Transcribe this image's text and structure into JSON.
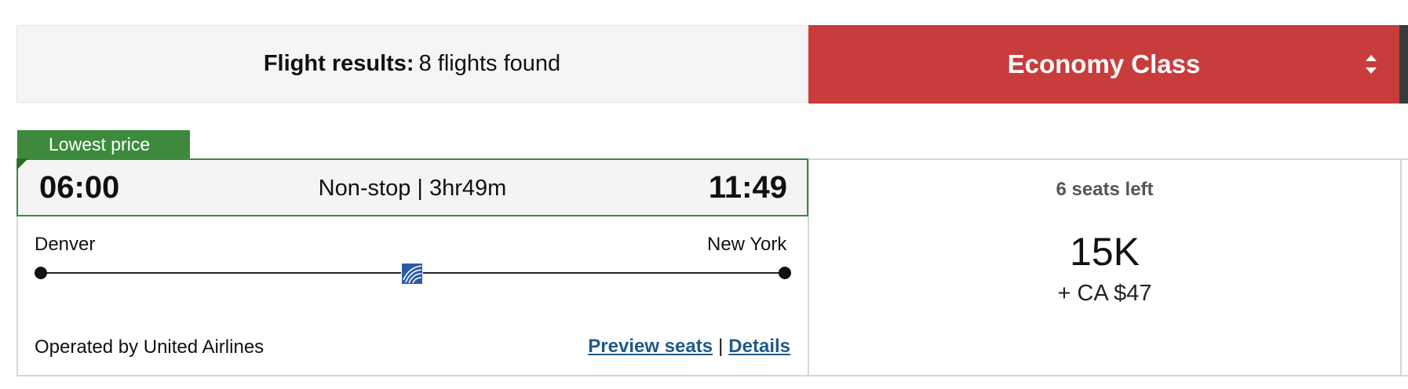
{
  "header": {
    "results_label": "Flight results:",
    "results_count": "8 flights found",
    "cabin_class": "Economy Class"
  },
  "flight": {
    "badge": "Lowest price",
    "departure_time": "06:00",
    "duration": "Non-stop | 3hr49m",
    "arrival_time": "11:49",
    "origin_city": "Denver",
    "destination_city": "New York",
    "operator": "Operated by United Airlines",
    "preview_seats_label": "Preview seats",
    "separator": "|",
    "details_label": "Details",
    "airline_logo_icon": "united-airlines-globe-icon"
  },
  "fare": {
    "seats_left": "6 seats left",
    "miles": "15K",
    "taxes": "+ CA $47"
  },
  "colors": {
    "cabin_header": "#c83c3b",
    "badge_green": "#3d8a3d",
    "link_blue": "#1f5a8a"
  }
}
